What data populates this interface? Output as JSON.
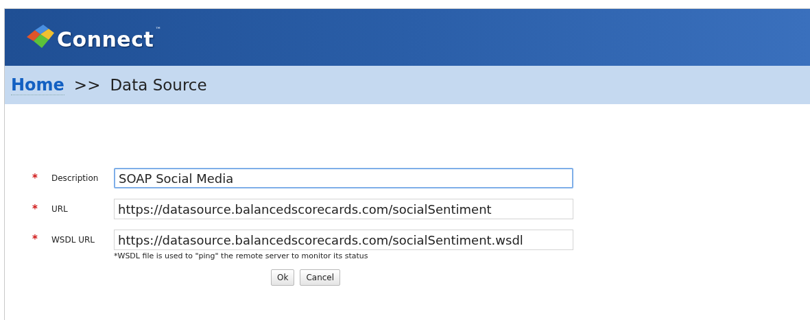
{
  "header": {
    "logo_text": "Connect",
    "trademark": "™"
  },
  "breadcrumb": {
    "home": "Home",
    "separator": ">>",
    "current": "Data Source"
  },
  "form": {
    "fields": [
      {
        "required_mark": "*",
        "label": "Description",
        "value": "SOAP Social Media",
        "focused": true
      },
      {
        "required_mark": "*",
        "label": "URL",
        "value": "https://datasource.balancedscorecards.com/socialSentiment",
        "focused": false
      },
      {
        "required_mark": "*",
        "label": "WSDL URL",
        "value": "https://datasource.balancedscorecards.com/socialSentiment.wsdl",
        "focused": false,
        "note": "*WSDL file is used to \"ping\" the remote server to monitor its status"
      }
    ],
    "buttons": [
      "Ok",
      "Cancel"
    ]
  }
}
